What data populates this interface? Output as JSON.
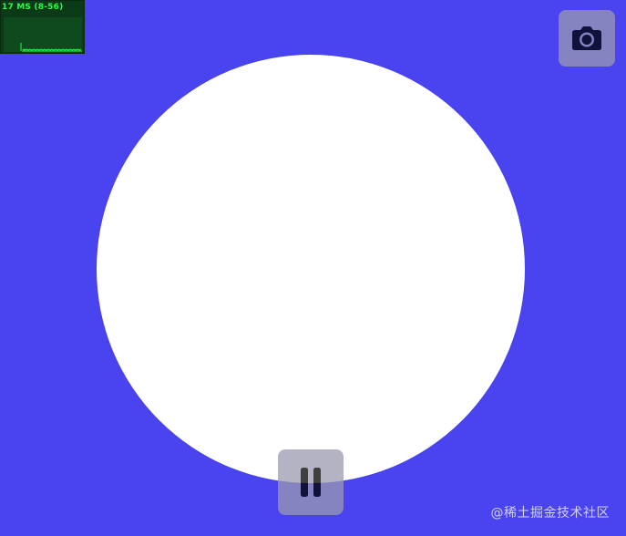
{
  "colors": {
    "background": "#4a44f0",
    "circle": "#ffffff",
    "stats_background": "#0b3a18",
    "stats_text": "#22ff44",
    "stats_graph_bg": "#0f4a1e",
    "button_bg": "#9a9ab0",
    "icon_color": "#000000",
    "watermark": "#d4d2f2"
  },
  "stats": {
    "label": "17 MS (8-56)"
  },
  "buttons": {
    "camera_icon": "camera-icon",
    "pause_icon": "pause-icon"
  },
  "watermark": {
    "text": "@稀土掘金技术社区"
  }
}
